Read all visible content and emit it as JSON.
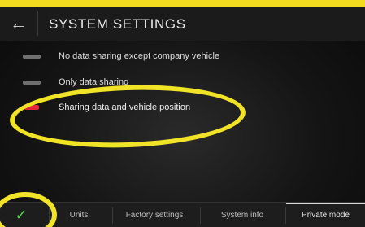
{
  "header": {
    "title": "SYSTEM SETTINGS",
    "back_icon": "arrow-left-icon"
  },
  "options": [
    {
      "label": "No data sharing except company vehicle",
      "selected": false
    },
    {
      "label": "Only data sharing",
      "selected": false
    },
    {
      "label": "Sharing data and vehicle position",
      "selected": true
    }
  ],
  "bottom_tabs": [
    {
      "label": "Units"
    },
    {
      "label": "Factory settings"
    },
    {
      "label": "System info"
    },
    {
      "label": "Private mode"
    }
  ],
  "confirm_icon": "checkmark-icon",
  "colors": {
    "annotation": "#f0e328",
    "selected_indicator": "#e0283a",
    "confirm": "#4fd24a"
  }
}
